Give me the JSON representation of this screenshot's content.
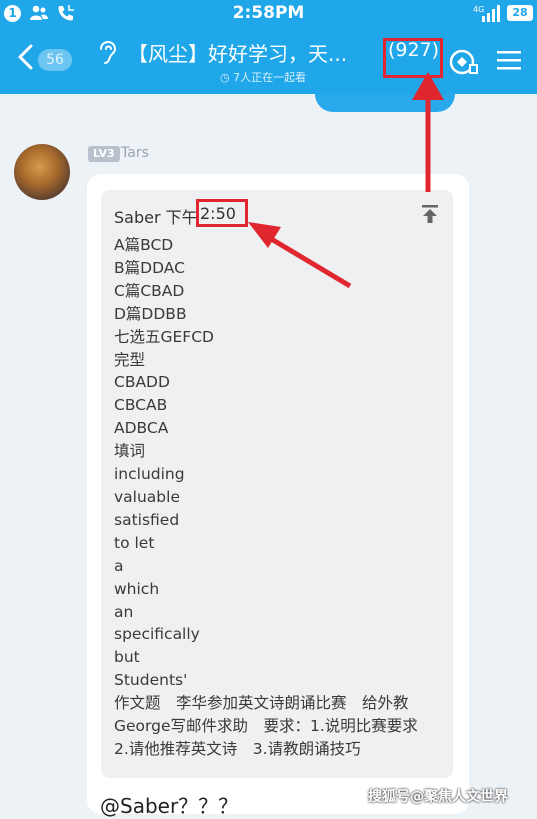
{
  "status_bar": {
    "sim_label": "1",
    "time": "2:58PM",
    "battery": "28",
    "network": "4G"
  },
  "header": {
    "back_badge": "56",
    "title": "【风尘】好好学习，天...",
    "member_count": "(927)",
    "subtitle": "7人正在一起看"
  },
  "message": {
    "level_badge": "LV3",
    "sender": "Tars",
    "quote_head": "Saber 下午",
    "quote_time": "2:50",
    "lines": [
      "A篇BCD",
      "B篇DDAC",
      "C篇CBAD",
      "D篇DDBB",
      "七选五GEFCD",
      "完型",
      "CBADD",
      "CBCAB",
      "ADBCA",
      "填词",
      "including",
      "valuable",
      "satisfied",
      "to let",
      "a",
      "which",
      "an",
      "specifically",
      "but",
      "Students'",
      "作文题　李华参加英文诗朗诵比赛　给外教George写邮件求助　要求：1.说明比赛要求　2.请他推荐英文诗　3.请教朗诵技巧"
    ],
    "reply": "@Saber？？？"
  },
  "watermark": "搜狐号@聚焦人文世界",
  "colors": {
    "header": "#1fa7ea",
    "annotation": "#e0262e",
    "background": "#edf2f7"
  }
}
